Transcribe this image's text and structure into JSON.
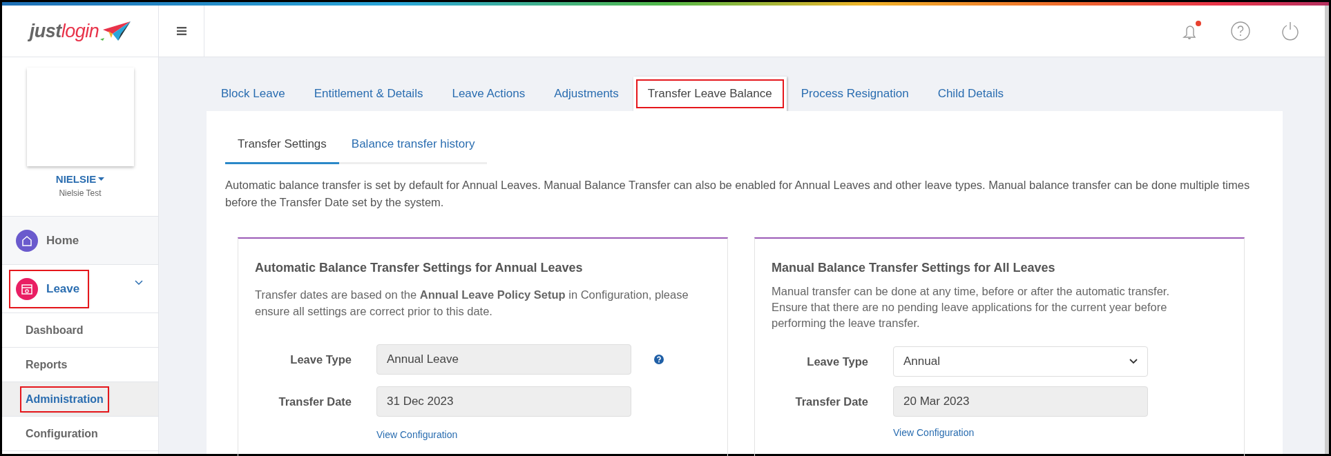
{
  "header": {
    "logo": {
      "dark_part": "just",
      "red_part": "login"
    },
    "notification_unread": true
  },
  "profile": {
    "username": "NIELSIE",
    "full_name": "Nielsie Test"
  },
  "sidebar": {
    "items": [
      {
        "label": "Home",
        "kind": "module",
        "selected": false,
        "expanded": false,
        "highlighted": false
      },
      {
        "label": "Leave",
        "kind": "module",
        "selected": true,
        "expanded": true,
        "highlighted": true
      },
      {
        "label": "Dashboard",
        "kind": "sub",
        "selected": false,
        "highlighted": false
      },
      {
        "label": "Reports",
        "kind": "sub",
        "selected": false,
        "highlighted": false
      },
      {
        "label": "Administration",
        "kind": "sub",
        "selected": true,
        "highlighted": true
      },
      {
        "label": "Configuration",
        "kind": "sub",
        "selected": false,
        "highlighted": false
      }
    ]
  },
  "tabs": [
    {
      "label": "Block Leave",
      "selected": false,
      "highlighted": false
    },
    {
      "label": "Entitlement & Details",
      "selected": false,
      "highlighted": false
    },
    {
      "label": "Leave Actions",
      "selected": false,
      "highlighted": false
    },
    {
      "label": "Adjustments",
      "selected": false,
      "highlighted": false
    },
    {
      "label": "Transfer Leave Balance",
      "selected": true,
      "highlighted": true
    },
    {
      "label": "Process Resignation",
      "selected": false,
      "highlighted": false
    },
    {
      "label": "Child Details",
      "selected": false,
      "highlighted": false
    }
  ],
  "subtabs": [
    {
      "label": "Transfer Settings",
      "selected": true
    },
    {
      "label": "Balance transfer history",
      "selected": false
    }
  ],
  "intro": "Automatic balance transfer is set by default for Annual Leaves. Manual Balance Transfer can also be enabled for Annual Leaves and other leave types. Manual balance transfer can be done multiple times before the Transfer Date set by the system.",
  "panels": [
    {
      "title": "Automatic Balance Transfer Settings for Annual Leaves",
      "description": "Transfer dates are based on the **Annual Leave Policy Setup** in Configuration, please ensure all settings are correct prior to this date.",
      "fields": [
        {
          "label": "Leave Type",
          "kind": "readonly",
          "value": "Annual Leave",
          "help": true
        },
        {
          "label": "Transfer Date",
          "kind": "readonly",
          "value": "31 Dec 2023",
          "help": false
        }
      ],
      "link": "View Configuration"
    },
    {
      "title": "Manual Balance Transfer Settings for All Leaves",
      "description": "Manual transfer can be done at any time, before or after the automatic transfer. Ensure that there are no pending leave applications for the current year before performing the leave transfer.",
      "fields": [
        {
          "label": "Leave Type",
          "kind": "select",
          "value": "Annual",
          "help": false
        },
        {
          "label": "Transfer Date",
          "kind": "readonly",
          "value": "20 Mar 2023",
          "help": false
        }
      ],
      "link": "View Configuration"
    }
  ]
}
